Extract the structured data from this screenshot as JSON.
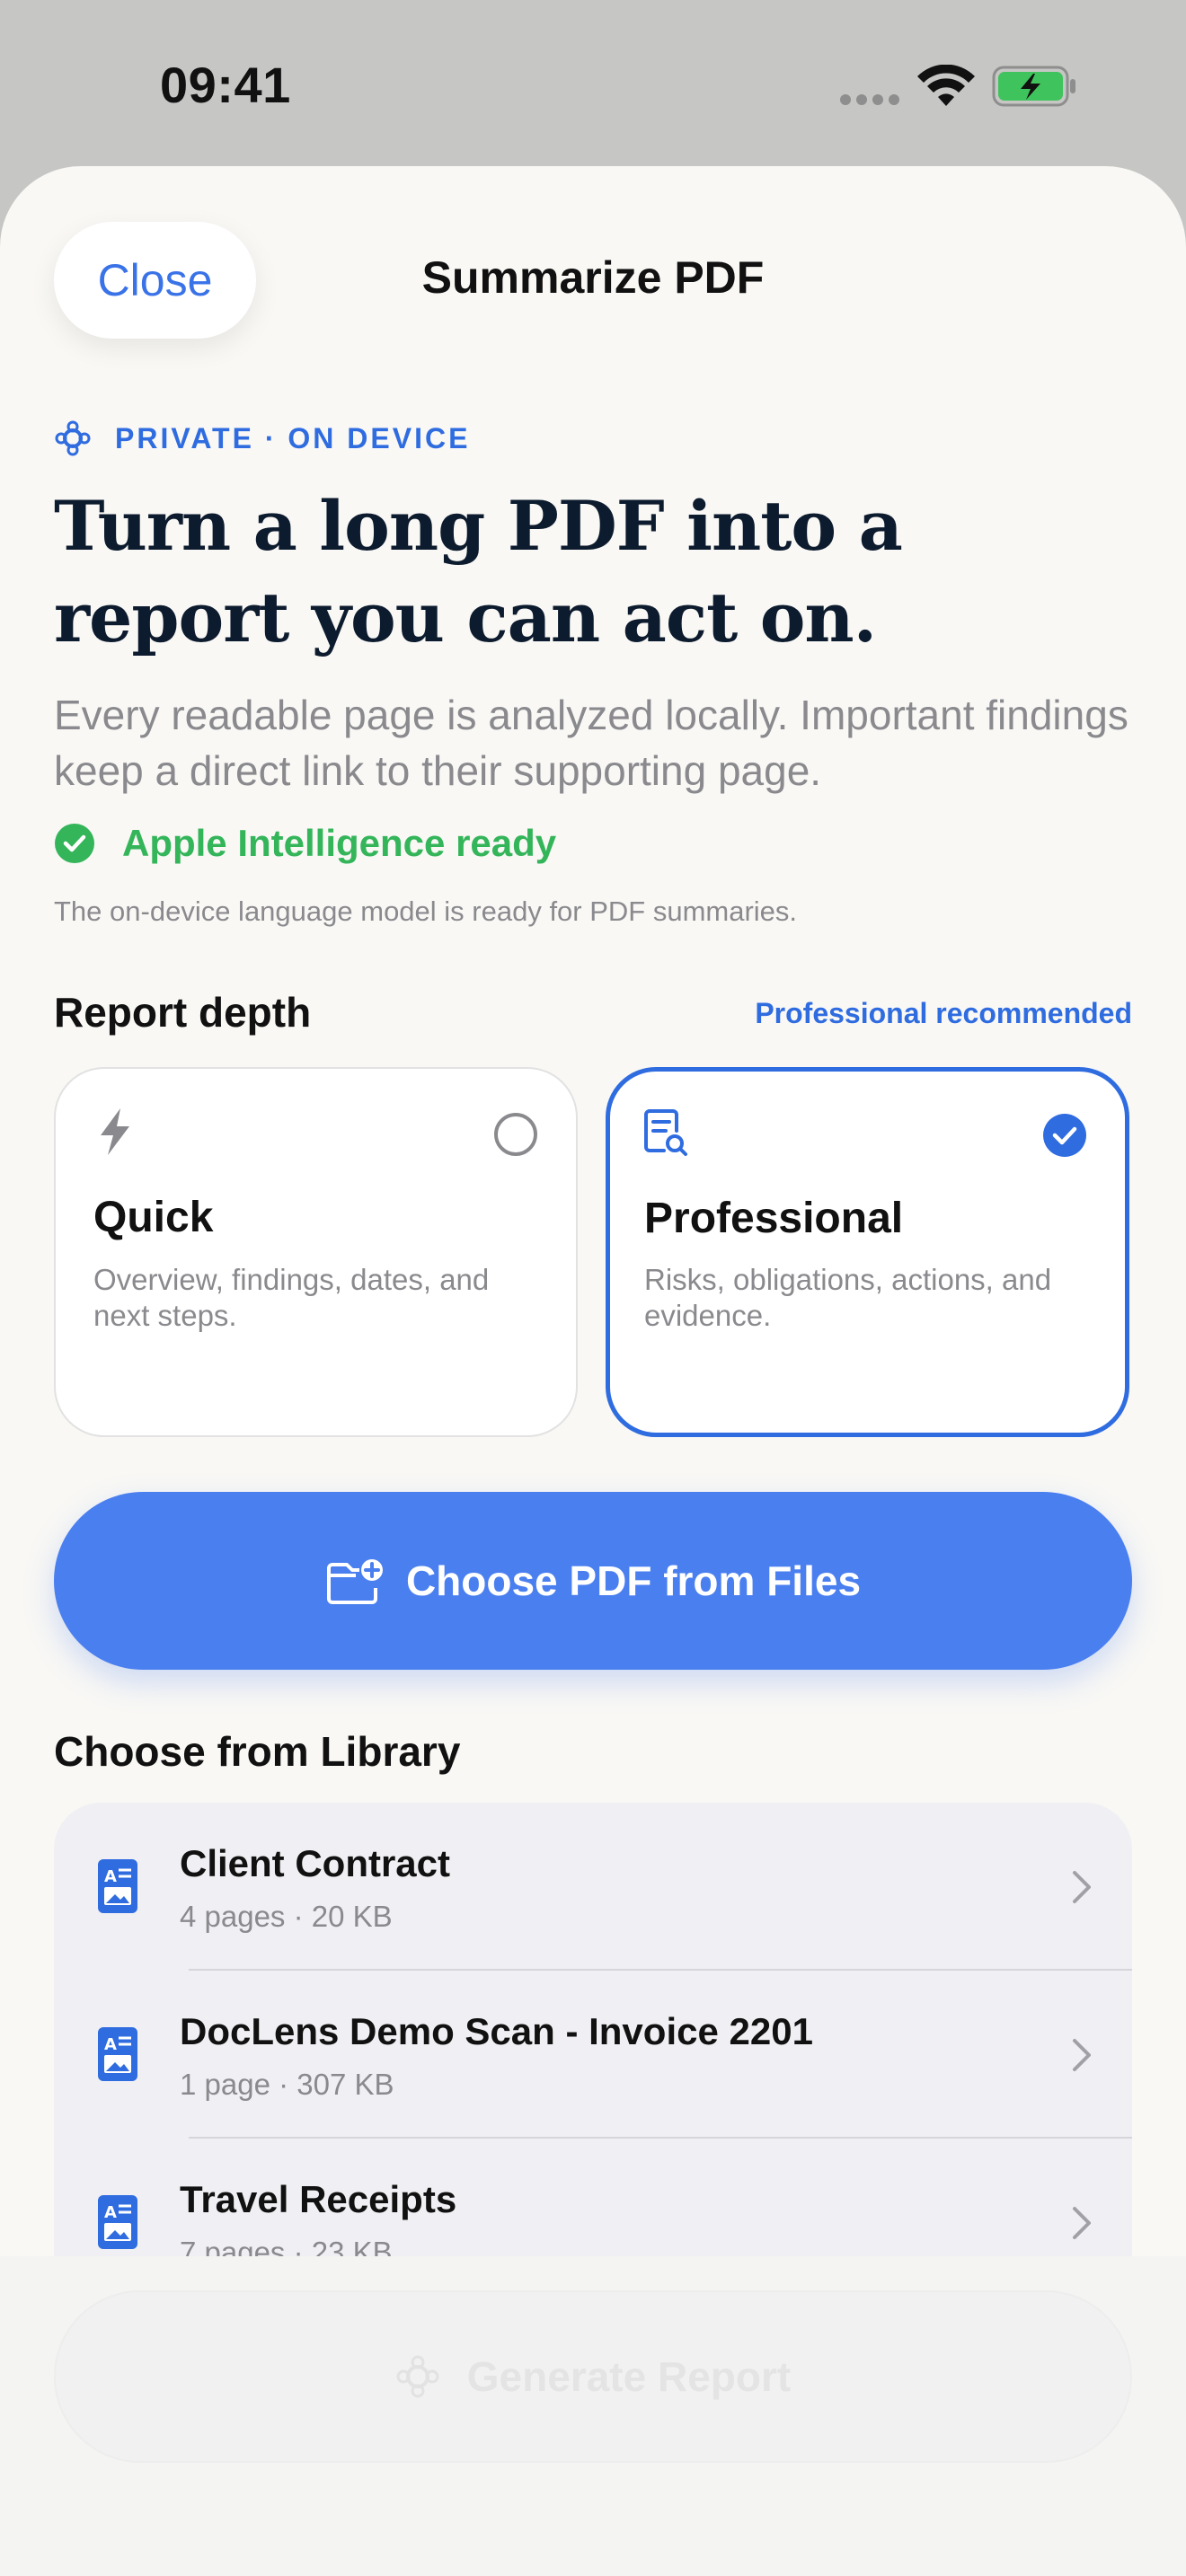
{
  "status_bar": {
    "time": "09:41"
  },
  "sheet": {
    "close_label": "Close",
    "title": "Summarize PDF"
  },
  "hero": {
    "eyebrow": "PRIVATE · ON DEVICE",
    "headline": "Turn a long PDF into a report you can act on.",
    "subtitle": "Every readable page is analyzed locally. Important findings keep a direct link to their supporting page.",
    "ready_text": "Apple Intelligence ready",
    "ready_note": "The on-device language model is ready for PDF summaries."
  },
  "depth": {
    "label": "Report depth",
    "recommendation": "Professional recommended",
    "options": [
      {
        "title": "Quick",
        "description": "Overview, findings, dates, and next steps.",
        "selected": false,
        "icon": "bolt-icon"
      },
      {
        "title": "Professional",
        "description": "Risks, obligations, actions, and evidence.",
        "selected": true,
        "icon": "document-search-icon"
      }
    ]
  },
  "choose_button": {
    "label": "Choose PDF from Files",
    "icon": "folder-add-icon"
  },
  "library": {
    "label": "Choose from Library",
    "items": [
      {
        "title": "Client Contract",
        "meta": "4 pages · 20 KB"
      },
      {
        "title": "DocLens Demo Scan - Invoice 2201",
        "meta": "1 page · 307 KB"
      },
      {
        "title": "Travel Receipts",
        "meta": "7 pages · 23 KB"
      }
    ]
  },
  "generate_button": {
    "label": "Generate Report",
    "enabled": false
  },
  "colors": {
    "accent": "#2f6ce0",
    "button_blue": "#4a7ff0",
    "ready_green": "#34b55a",
    "sheet_bg": "#f9f8f5"
  }
}
